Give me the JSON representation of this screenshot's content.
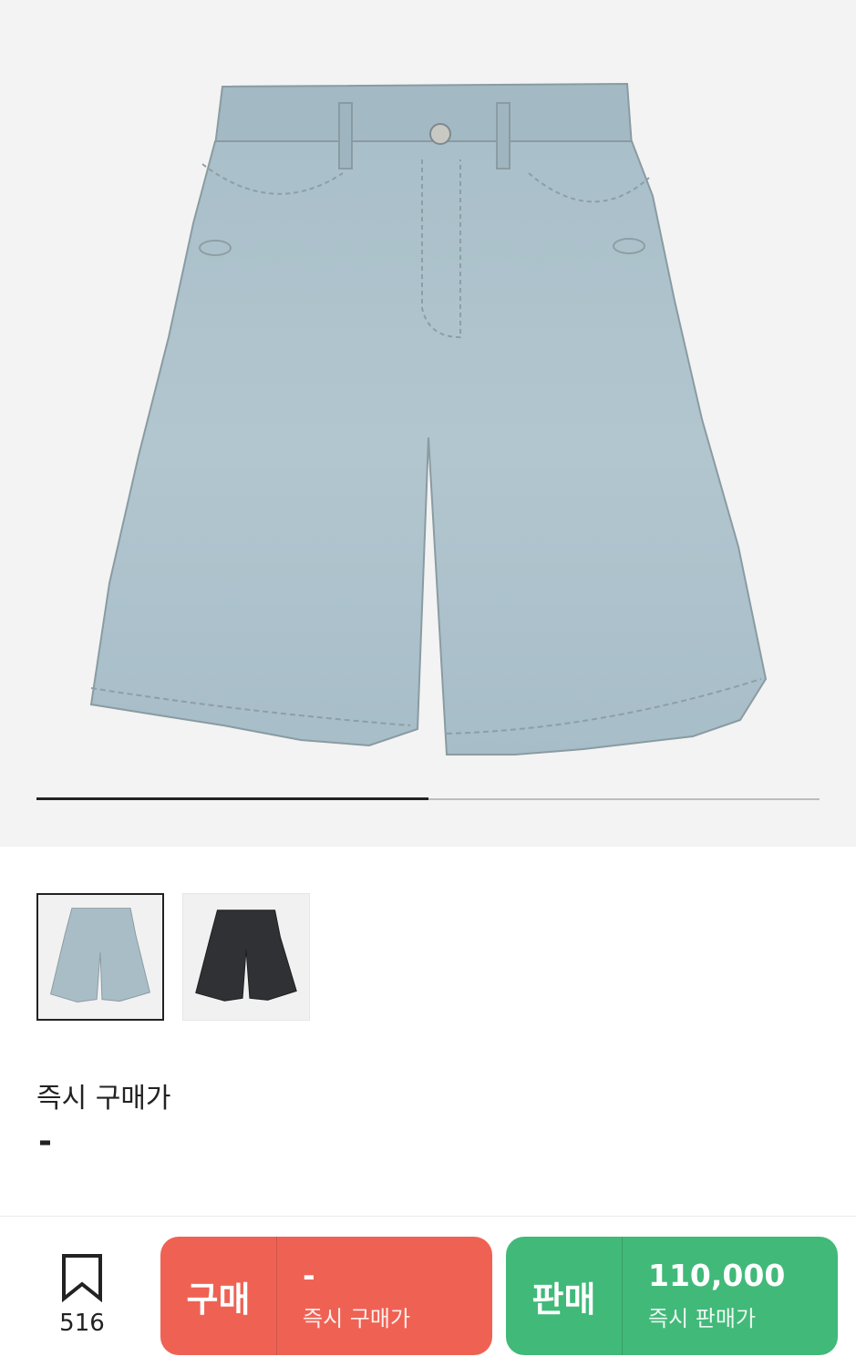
{
  "product": {
    "image_alt": "Light wash denim shorts",
    "gallery_progress": 0.5
  },
  "thumbnails": [
    {
      "alt": "light-blue-denim-shorts",
      "color": "#a8bfcc"
    },
    {
      "alt": "black-denim-shorts",
      "color": "#2f3134"
    }
  ],
  "price": {
    "label": "즉시 구매가",
    "value": "-"
  },
  "bottom_bar": {
    "wish_count": "516",
    "buy": {
      "label": "구매",
      "price": "-",
      "sub": "즉시 구매가"
    },
    "sell": {
      "label": "판매",
      "price": "110,000",
      "sub": "즉시 판매가"
    }
  },
  "colors": {
    "buy": "#ef6253",
    "sell": "#41b979",
    "hero_bg": "#f3f3f3"
  }
}
